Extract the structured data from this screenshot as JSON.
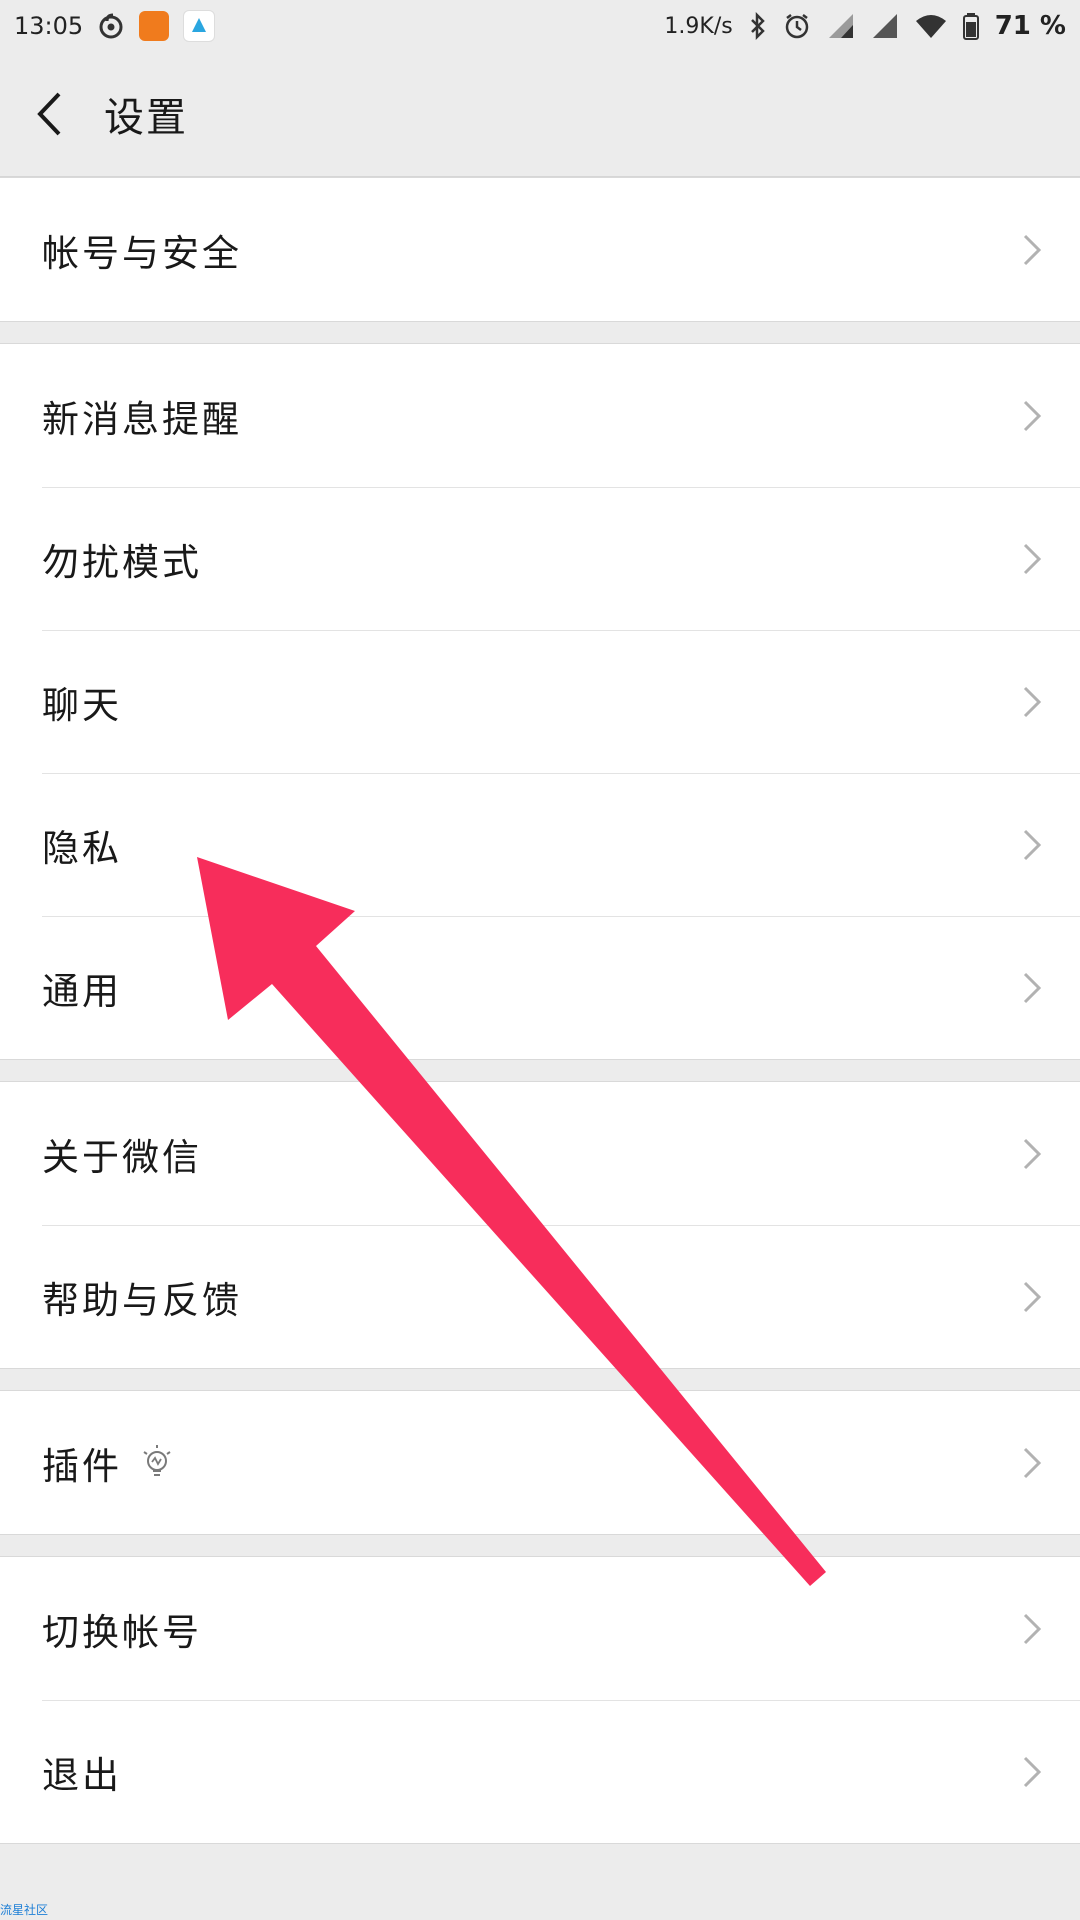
{
  "status_bar": {
    "time": "13:05",
    "net_speed": "1.9K/s",
    "battery": "71 %",
    "icons": [
      "netease-music-icon",
      "mi-app-icon",
      "drive-app-icon",
      "bluetooth-icon",
      "alarm-icon",
      "signal-icon",
      "signal-icon",
      "wifi-icon",
      "battery-icon"
    ]
  },
  "header": {
    "title": "设置",
    "back_icon": "chevron-left-icon"
  },
  "groups": [
    {
      "items": [
        {
          "label": "帐号与安全"
        }
      ]
    },
    {
      "items": [
        {
          "label": "新消息提醒"
        },
        {
          "label": "勿扰模式"
        },
        {
          "label": "聊天"
        },
        {
          "label": "隐私"
        },
        {
          "label": "通用"
        }
      ]
    },
    {
      "items": [
        {
          "label": "关于微信"
        },
        {
          "label": "帮助与反馈"
        }
      ]
    },
    {
      "items": [
        {
          "label": "插件",
          "extra_icon": "lightbulb-icon"
        }
      ]
    },
    {
      "items": [
        {
          "label": "切换帐号"
        },
        {
          "label": "退出"
        }
      ]
    }
  ],
  "watermark": "流星社区",
  "colors": {
    "background": "#ececec",
    "row_background": "#ffffff",
    "annotation_arrow": "#f72d5b",
    "chevron": "#b2b2b2"
  }
}
